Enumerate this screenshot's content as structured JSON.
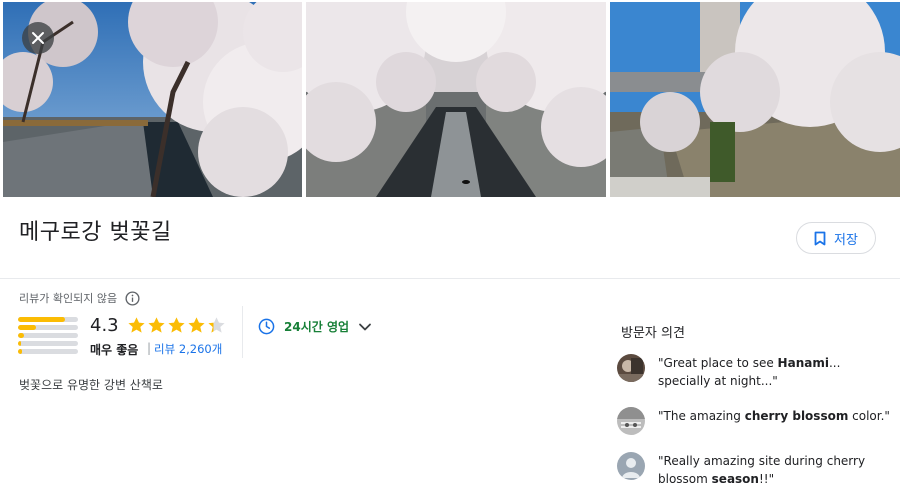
{
  "photos": [
    {
      "alt": "cherry blossom canal photo 1"
    },
    {
      "alt": "cherry blossom canal photo 2"
    },
    {
      "alt": "cherry blossom canal photo 3"
    }
  ],
  "header": {
    "close_icon": "close-icon",
    "title": "메구로강 벚꽃길",
    "save_label": "저장",
    "save_icon": "bookmark-icon"
  },
  "reviews": {
    "unverified_note": "리뷰가 확인되지 않음",
    "info_icon": "info-icon",
    "rating": "4.3",
    "rating_value": 4.3,
    "rating_max": 5,
    "rating_label": "매우 좋음",
    "separator": "|",
    "review_count_label": "리뷰 2,260개",
    "distribution": [
      0.78,
      0.3,
      0.1,
      0.05,
      0.06
    ]
  },
  "hours": {
    "icon": "clock-icon",
    "label": "24시간 영업",
    "chevron": "chevron-down-icon"
  },
  "description": "벚꽃으로 유명한 강변 산책로",
  "opinions": {
    "title": "방문자 의견",
    "items": [
      {
        "pre": "\"Great place to see ",
        "bold": "Hanami",
        "post": "... specially at night...\""
      },
      {
        "pre": "\"The amazing ",
        "bold": "cherry blossom",
        "post": " color.\""
      },
      {
        "pre": "\"Really amazing site during cherry blossom ",
        "bold": "season",
        "post": "!!\""
      }
    ]
  },
  "colors": {
    "accent": "#1a73e8",
    "open": "#188038",
    "star": "#fbbc04"
  }
}
